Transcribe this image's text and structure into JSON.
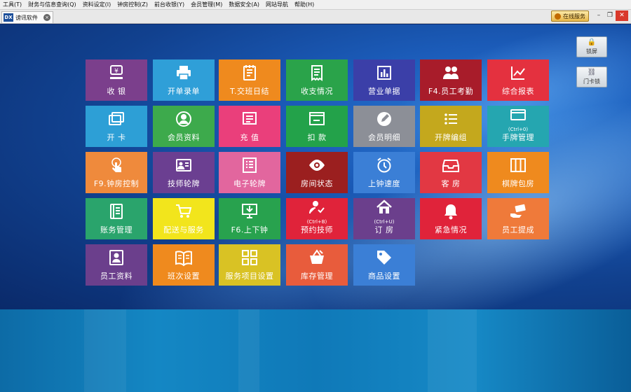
{
  "menubar": {
    "items": [
      "工具(T)",
      "财务与信息查询(Q)",
      "资料设定(I)",
      "钟房控制(Z)",
      "前台收银(Y)",
      "会员管理(M)",
      "数据安全(A)",
      "网站导航",
      "帮助(H)"
    ]
  },
  "tab": {
    "badge": "DX",
    "title": "谤讯软件",
    "close": "×"
  },
  "online_service": {
    "label": "在线服务"
  },
  "window_controls": {
    "minimize": "–",
    "restore": "❐",
    "close": "✕"
  },
  "side_buttons": [
    {
      "label": "锁屏",
      "icon": "lock-icon",
      "glyph": "🔒"
    },
    {
      "label": "门卡锁",
      "icon": "card-lock-icon",
      "glyph": "⛓"
    }
  ],
  "tiles": [
    {
      "label": "收 银",
      "color": "#7b3f8c",
      "icon": "cashier-icon"
    },
    {
      "label": "开单录单",
      "color": "#2f9fd8",
      "icon": "printer-icon"
    },
    {
      "label": "T.交班日结",
      "color": "#ef8a1e",
      "icon": "ledger-icon"
    },
    {
      "label": "收支情况",
      "color": "#2aa34a",
      "icon": "receipt-icon"
    },
    {
      "label": "营业单据",
      "color": "#3b3fa8",
      "icon": "bar-chart-icon"
    },
    {
      "label": "F4.员工考勤",
      "color": "#a81c2a",
      "icon": "staff-icon"
    },
    {
      "label": "综合报表",
      "color": "#e4313f",
      "icon": "line-chart-icon"
    },
    {
      "label": "开 卡",
      "color": "#2d9fd6",
      "icon": "cards-icon"
    },
    {
      "label": "会员资料",
      "color": "#3daa4c",
      "icon": "member-icon"
    },
    {
      "label": "充 值",
      "color": "#ea3f7b",
      "icon": "recharge-icon"
    },
    {
      "label": "扣 款",
      "color": "#23a24a",
      "icon": "window-icon"
    },
    {
      "label": "会员明细",
      "color": "#8c8f97",
      "icon": "edit-icon"
    },
    {
      "label": "开牌编组",
      "color": "#c4a81d",
      "icon": "list-icon"
    },
    {
      "label": "手牌管理",
      "sub": "(Ctrl+0)",
      "color": "#25a6b0",
      "icon": "card-icon"
    },
    {
      "label": "F9.钟房控制",
      "color": "#ef8a3c",
      "icon": "touch-icon"
    },
    {
      "label": "技师轮牌",
      "color": "#6b3f91",
      "icon": "id-card-icon"
    },
    {
      "label": "电子轮牌",
      "color": "#e2669e",
      "icon": "e-board-icon"
    },
    {
      "label": "房间状态",
      "color": "#9b1f1f",
      "icon": "eye-icon"
    },
    {
      "label": "上钟速度",
      "color": "#3b7fd6",
      "icon": "alarm-clock-icon"
    },
    {
      "label": "客 房",
      "color": "#e23843",
      "icon": "inbox-icon"
    },
    {
      "label": "棋牌包房",
      "color": "#ef8a1e",
      "icon": "columns-icon"
    },
    {
      "label": "账务管理",
      "color": "#2aa46c",
      "icon": "account-book-icon"
    },
    {
      "label": "配送与服务",
      "color": "#f2e51c",
      "icon": "cart-icon"
    },
    {
      "label": "F6.上下钟",
      "color": "#28a24e",
      "icon": "download-monitor-icon"
    },
    {
      "label": "预约技师",
      "sub": "(Ctrl+B)",
      "color": "#e0233a",
      "icon": "reserve-icon"
    },
    {
      "label": "订 房",
      "sub": "(Ctrl+U)",
      "color": "#6b3f8c",
      "icon": "home-icon"
    },
    {
      "label": "紧急情况",
      "color": "#e0233a",
      "icon": "bell-icon"
    },
    {
      "label": "员工提成",
      "color": "#ef7a3a",
      "icon": "cash-hand-icon"
    },
    {
      "label": "员工资料",
      "color": "#6b3f8c",
      "icon": "profile-icon"
    },
    {
      "label": "班次设置",
      "color": "#ef8a1e",
      "icon": "book-icon"
    },
    {
      "label": "服务项目设置",
      "color": "#d9c224",
      "icon": "grid-icon"
    },
    {
      "label": "库存管理",
      "color": "#e85c3c",
      "icon": "basket-icon"
    },
    {
      "label": "商品设置",
      "color": "#3b7fd6",
      "icon": "tag-icon"
    }
  ]
}
